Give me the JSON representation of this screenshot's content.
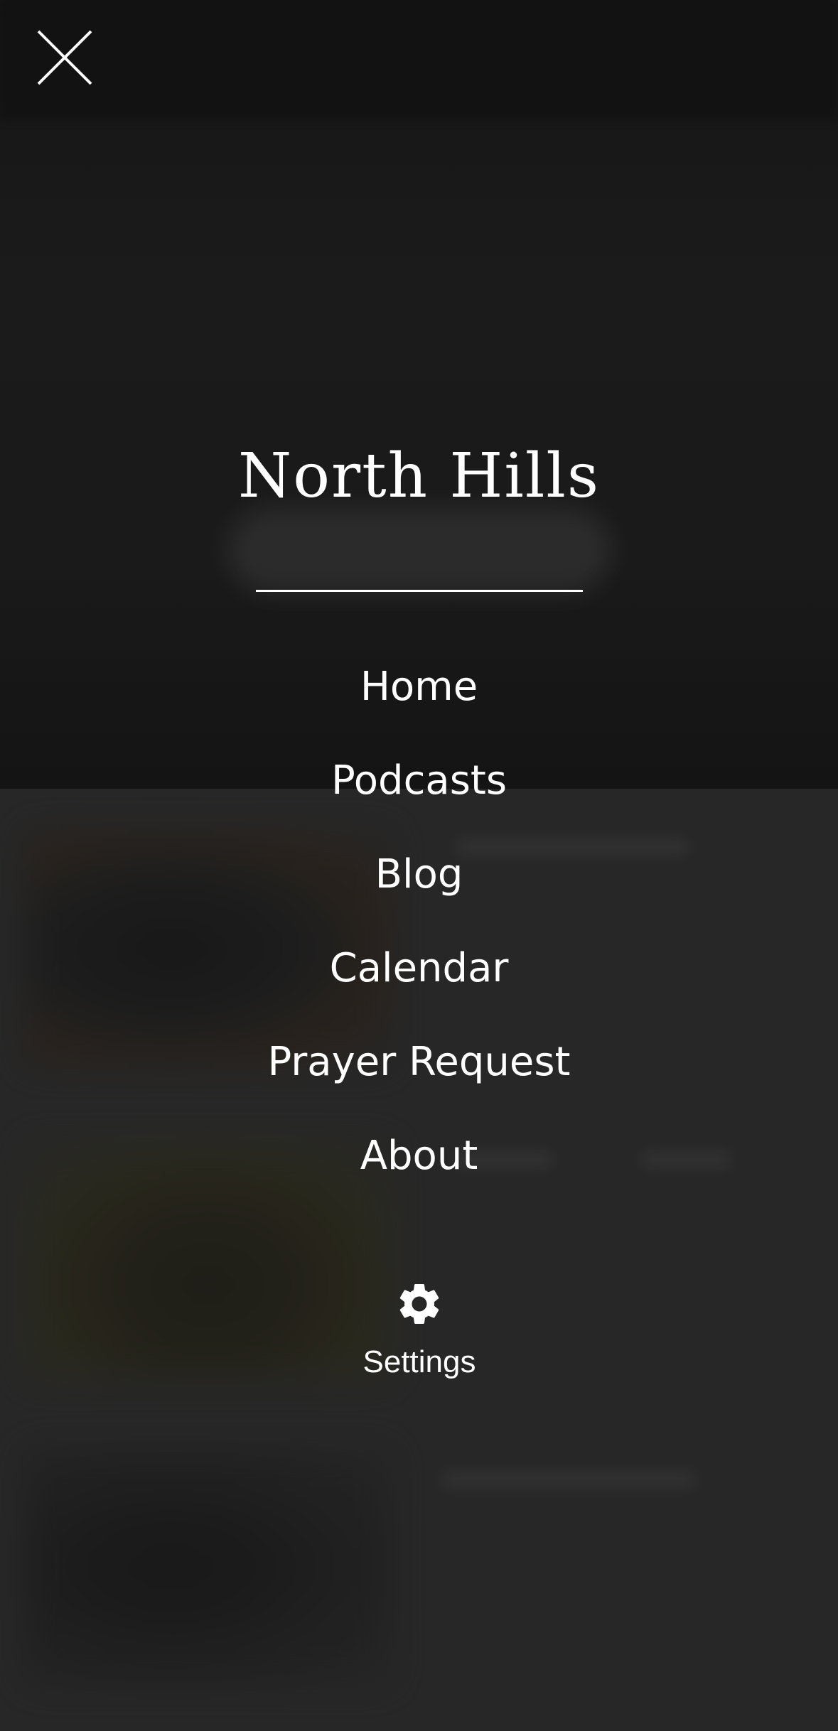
{
  "header": {
    "close_icon": "close-icon"
  },
  "brand": {
    "title": "North Hills"
  },
  "menu": {
    "items": [
      {
        "label": "Home"
      },
      {
        "label": "Podcasts"
      },
      {
        "label": "Blog"
      },
      {
        "label": "Calendar"
      },
      {
        "label": "Prayer Request"
      },
      {
        "label": "About"
      }
    ]
  },
  "settings": {
    "icon": "gear-icon",
    "label": "Settings"
  },
  "colors": {
    "overlay_dark": "#141414",
    "list_background": "#262626",
    "text": "#ffffff"
  }
}
